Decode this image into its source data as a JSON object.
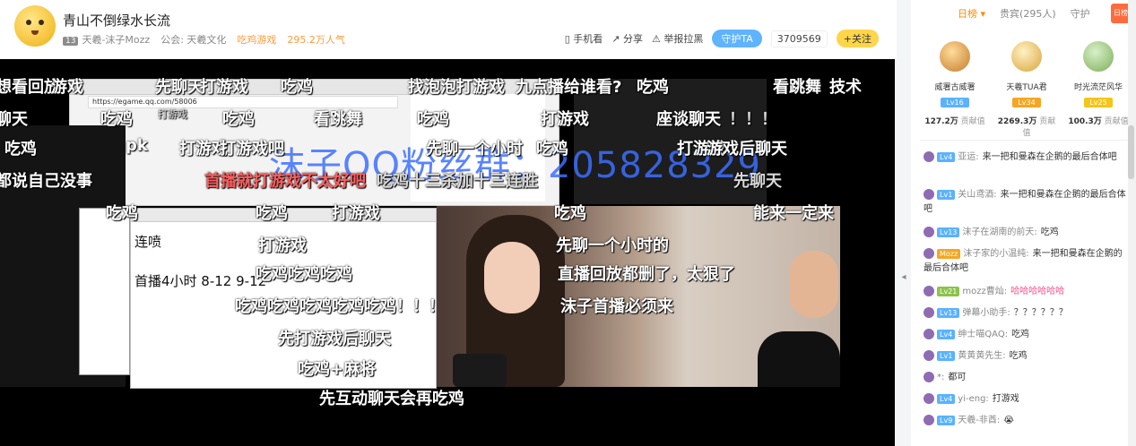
{
  "header": {
    "title": "青山不倒绿水长流",
    "level": "13",
    "streamer": "天羲-沫子Mozz",
    "guild": "公会: 天羲文化",
    "category": "吃鸡游戏",
    "popularity": "295.2万人气",
    "actions": {
      "mobile": "手机看",
      "share": "分享",
      "report": "举报拉黑",
      "guard": "守护TA",
      "fans": "3709569",
      "follow": "+关注"
    }
  },
  "video": {
    "address": "https://egame.qq.com/58006",
    "watermark": "沫子QQ粉丝群：205828329",
    "notepad": [
      "连喷",
      "首播4小时 8-12 9-12"
    ],
    "danmaku": [
      "想看回放",
      "游戏",
      "先聊天",
      "打游戏",
      "吃鸡",
      "找泡泡打游戏",
      "九点播给谁看?",
      "吃鸡",
      "看跳舞",
      "技术",
      "聊天",
      "吃鸡",
      "打游戏",
      "吃鸡",
      "看跳舞",
      "吃鸡",
      "打游戏",
      "座谈聊天",
      "！！！",
      "吃鸡",
      "pk",
      "打游戏",
      "打游戏吧",
      "先聊一个小时",
      "吃鸡",
      "打游戏",
      "游戏后聊天",
      "都说自己没事",
      "首播就打游戏不太好吧",
      "吃鸡十三杀加十三连胜",
      "先聊天",
      "吃鸡",
      "吃鸡",
      "打游戏",
      "吃鸡",
      "能来一定来",
      "打游戏",
      "先聊一个小时的",
      "吃鸡吃鸡吃鸡",
      "直播回放都删了，太狠了",
      "吃鸡吃鸡吃鸡吃鸡吃鸡！！！",
      "沫子首播必须来",
      "先打游戏后聊天",
      "吃鸡+麻将",
      "先互动聊天会再吃鸡"
    ]
  },
  "sidebar": {
    "tabs": [
      "日榜",
      "贵宾(295人)",
      "守护"
    ],
    "rank_badge": "日榜",
    "podium": [
      {
        "name": "威署古威署",
        "level": "Lv16",
        "value": "127.2万",
        "unit": "贡献值",
        "color": "#5ab2ff"
      },
      {
        "name": "天羲TUA君",
        "level": "Lv34",
        "value": "2269.3万",
        "unit": "贡献值",
        "color": "#f5a623"
      },
      {
        "name": "时光流茫风华",
        "level": "Lv25",
        "value": "100.3万",
        "unit": "贡献值",
        "color": "#f5c518"
      }
    ],
    "chat": [
      {
        "level": "Lv4",
        "user": "亚运:",
        "text": "来一把和曼森在企鹅的最后合体吧"
      },
      {
        "level": "Lv1",
        "user": "关山鸢酒:",
        "text": "来一把和曼森在企鹅的最后合体吧"
      },
      {
        "level": "Lv13",
        "user": "沫子在湖南的前天:",
        "text": "吃鸡"
      },
      {
        "level": "Mozz",
        "user": "沫子家的小温纯:",
        "text": "来一把和曼森在企鹅的最后合体吧"
      },
      {
        "level": "Lv21",
        "user": "mozz曹灿:",
        "text": "哈哈哈哈哈哈"
      },
      {
        "level": "Lv13",
        "user": "弹幕小助手:",
        "text": "？？？？？？"
      },
      {
        "level": "Lv4",
        "user": "绅士喵QAQ:",
        "text": "吃鸡"
      },
      {
        "level": "Lv1",
        "user": "黄黄黄先生:",
        "text": "吃鸡"
      },
      {
        "level": "",
        "user": "*:",
        "text": "都可"
      },
      {
        "level": "Lv4",
        "user": "yi-eng:",
        "text": "打游戏"
      },
      {
        "level": "Lv9",
        "user": "天羲-非酋:",
        "text": "😭"
      }
    ]
  }
}
